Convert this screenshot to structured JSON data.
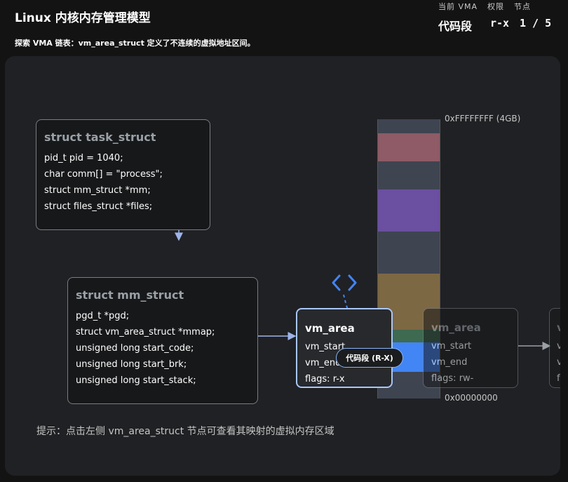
{
  "header": {
    "title": "Linux 内核内存管理模型",
    "subtitle": "探索 VMA 链表：vm_area_struct 定义了不连续的虚拟地址区间。",
    "status_labels": [
      "当前 VMA",
      "权限",
      "节点"
    ],
    "current_vma": "代码段",
    "permission": "r-x",
    "node_index": "1 / 5"
  },
  "task_struct": {
    "title": "struct task_struct",
    "fields": [
      "pid_t pid = 1040;",
      "char comm[] = \"process\";",
      "struct mm_struct *mm;",
      "struct files_struct *files;"
    ]
  },
  "mm_struct": {
    "title": "struct mm_struct",
    "fields": [
      "pgd_t *pgd;",
      "struct vm_area_struct *mmap;",
      "unsigned long start_code;",
      "unsigned long start_brk;",
      "unsigned long start_stack;"
    ]
  },
  "vma_nodes": [
    {
      "title": "vm_area",
      "fields": [
        "vm_start",
        "vm_end",
        "flags: r-x"
      ]
    },
    {
      "title": "vm_area",
      "fields": [
        "vm_start",
        "vm_end",
        "flags: rw-"
      ]
    },
    {
      "title": "v",
      "fields": [
        "v",
        "v",
        "f"
      ]
    }
  ],
  "memory": {
    "top_label": "0xFFFFFFFF (4GB)",
    "bottom_label": "0x00000000",
    "highlight_label": "代码段 (R-X)",
    "colors": {
      "stack": "#8e5b66",
      "mmap": "#6b4fa0",
      "heap": "#7d6844",
      "data": "#3d6a50",
      "code": "#4285f4",
      "empty": "#3f4451"
    }
  },
  "hint": "提示：点击左侧 vm_area_struct 节点可查看其映射的虚拟内存区域",
  "icons": {
    "code": "code-brackets-icon"
  }
}
